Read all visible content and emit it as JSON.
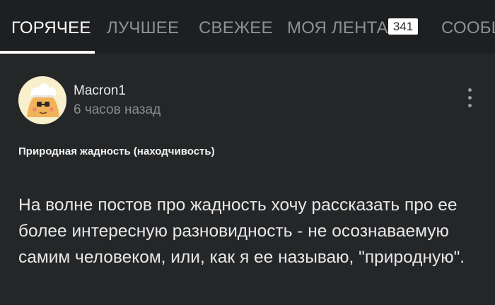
{
  "tabs": [
    {
      "label": "ГОРЯЧЕЕ",
      "active": true
    },
    {
      "label": "ЛУЧШЕЕ",
      "active": false
    },
    {
      "label": "СВЕЖЕЕ",
      "active": false
    },
    {
      "label": "МОЯ ЛЕНТА",
      "active": false,
      "badge": "341"
    },
    {
      "label": "СООБЩ",
      "active": false
    }
  ],
  "post": {
    "author": "Macron1",
    "time": "6 часов назад",
    "title": "Природная жадность (находчивость)",
    "body": "На волне постов про жадность хочу рассказать про ее более интересную разновидность - не осознаваемую самим человеком, или, как я ее называю, \"природную\"."
  },
  "icons": {
    "avatar": "chef-avatar-icon",
    "menu": "more-vertical-icon"
  },
  "colors": {
    "background": "#242628",
    "topbar": "#1d1f21",
    "active_tab": "#ffffff",
    "inactive_tab": "#8e9194"
  }
}
